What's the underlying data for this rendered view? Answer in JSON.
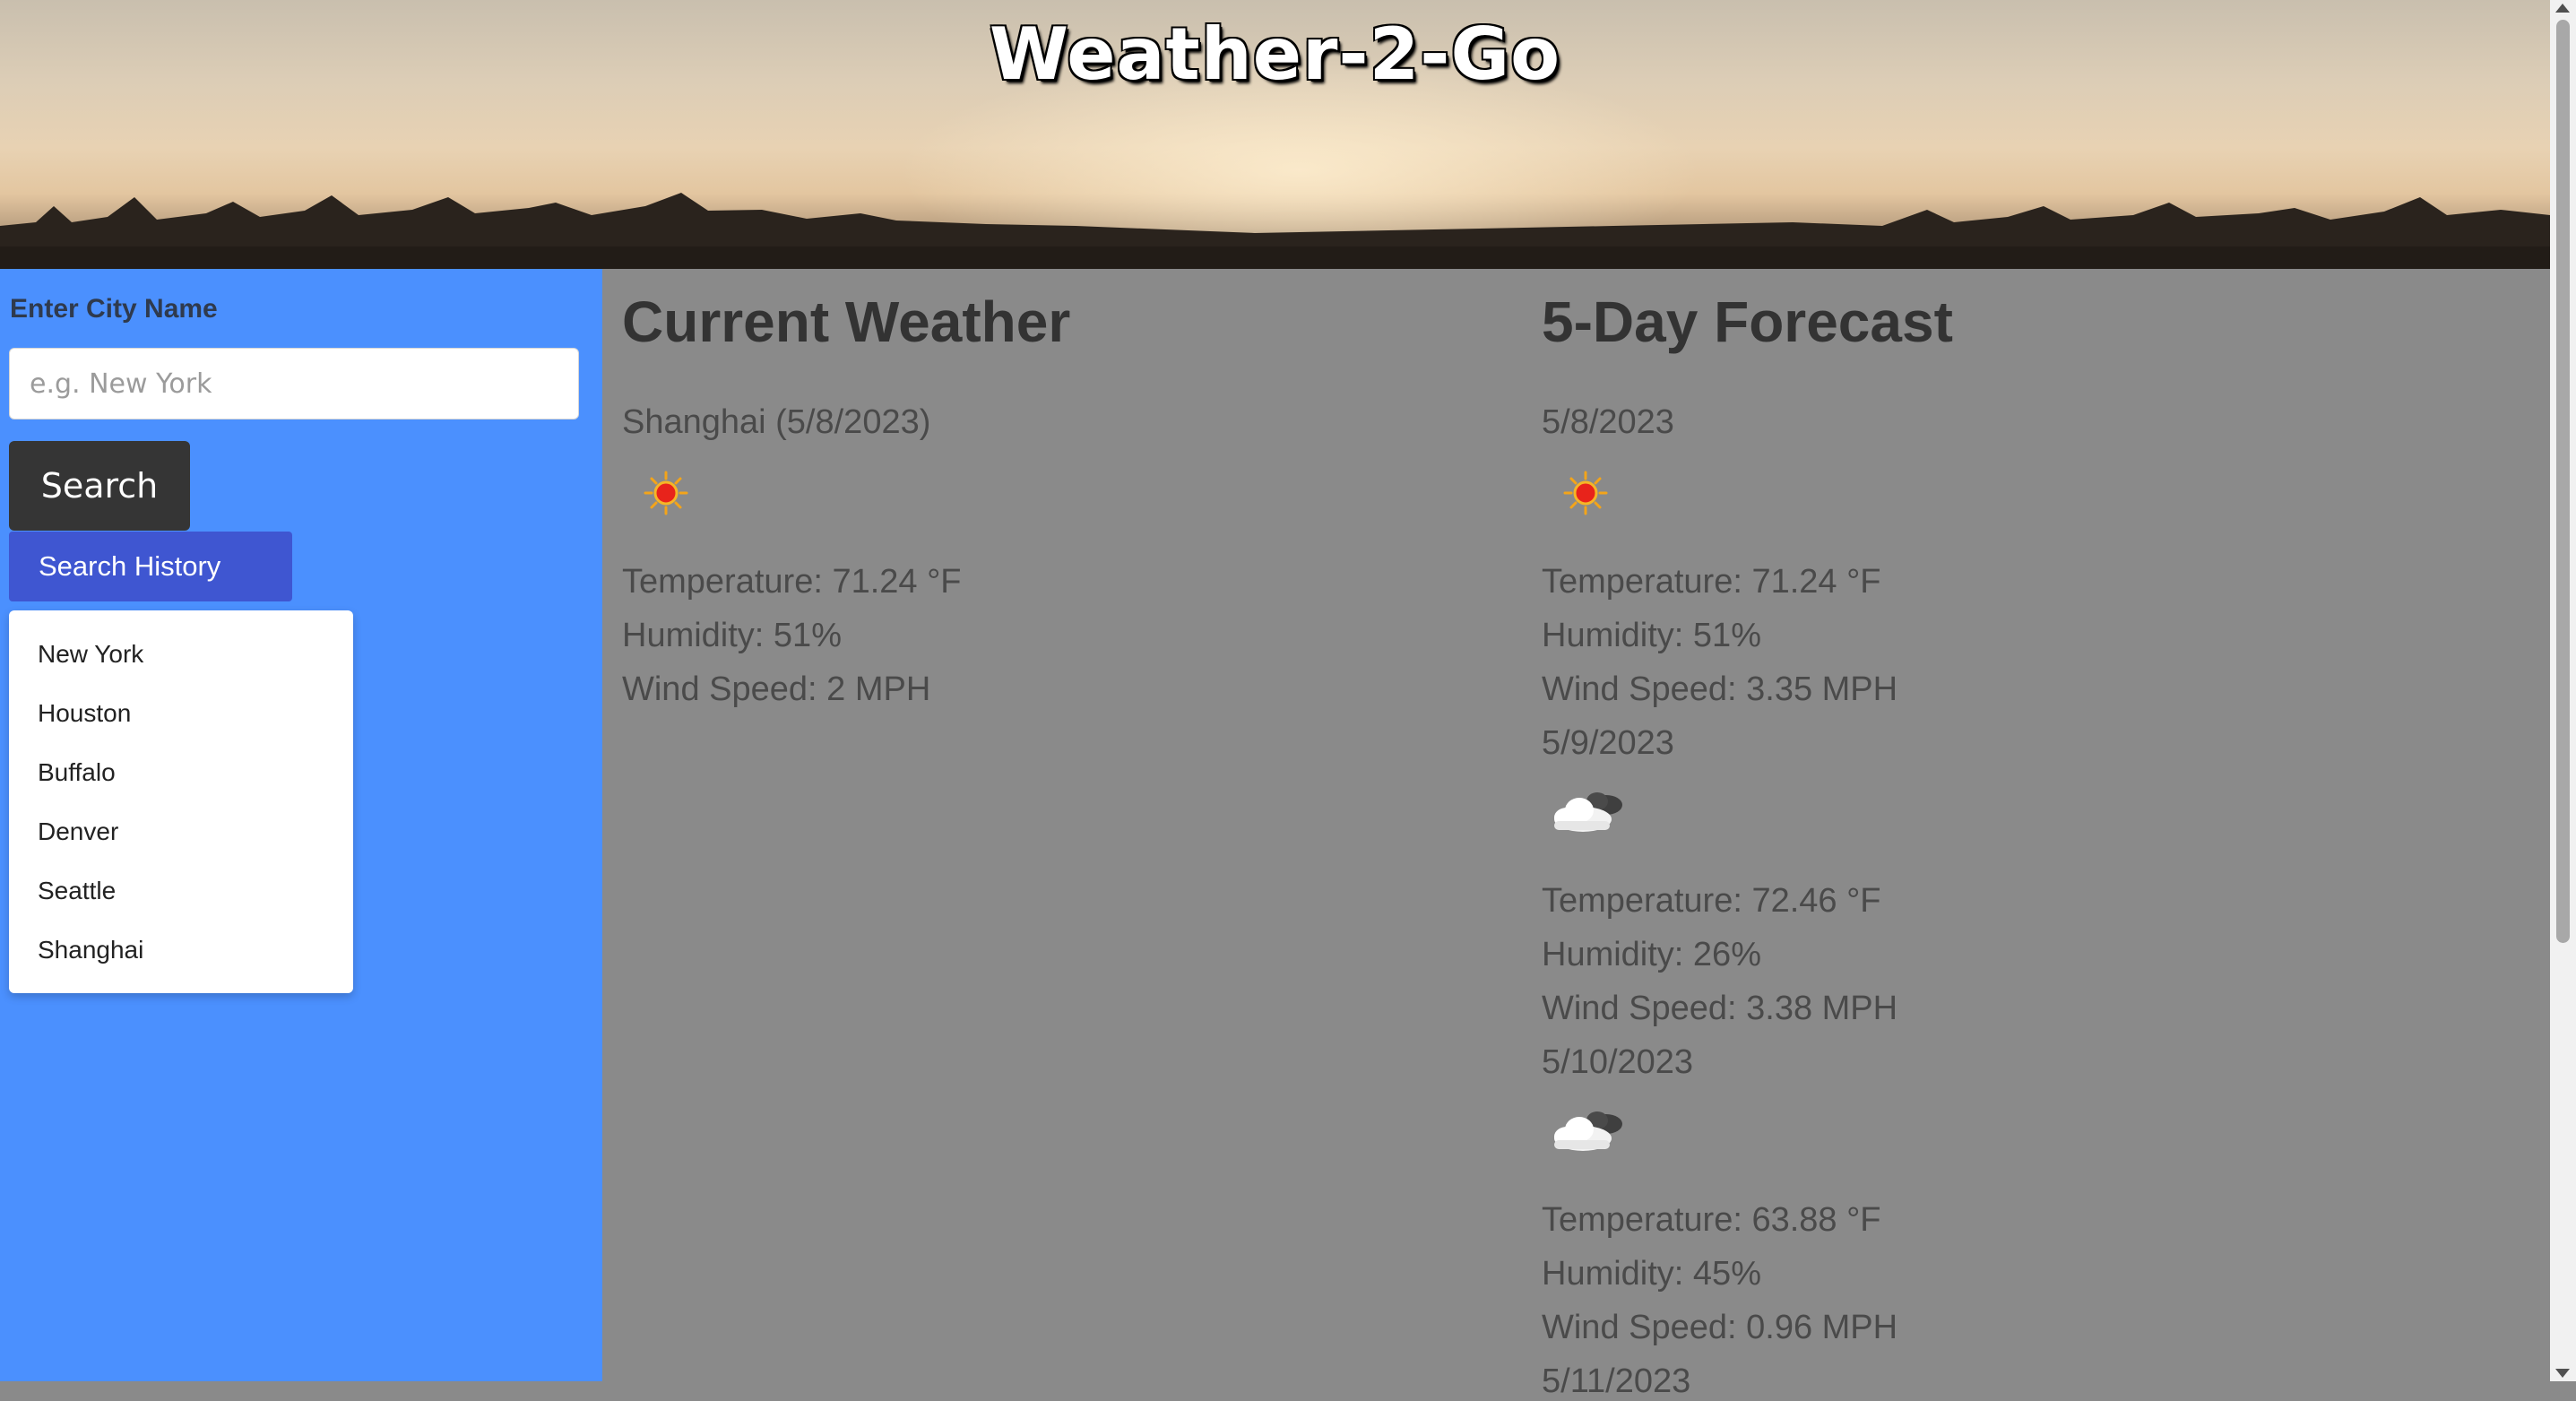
{
  "header": {
    "title": "Weather-2-Go"
  },
  "sidebar": {
    "city_label": "Enter City Name",
    "city_placeholder": "e.g. New York",
    "search_label": "Search",
    "history_label": "Search History",
    "history": [
      "New York",
      "Houston",
      "Buffalo",
      "Denver",
      "Seattle",
      "Shanghai"
    ]
  },
  "current": {
    "title": "Current Weather",
    "location": "Shanghai (5/8/2023)",
    "icon": "sun-icon",
    "temperature": "Temperature: 71.24 °F",
    "humidity": "Humidity: 51%",
    "wind": "Wind Speed: 2 MPH"
  },
  "forecast": {
    "title": "5-Day Forecast",
    "days": [
      {
        "date": "5/8/2023",
        "icon": "sun-icon",
        "temperature": "Temperature: 71.24 °F",
        "humidity": "Humidity: 51%",
        "wind": "Wind Speed: 3.35 MPH"
      },
      {
        "date": "5/9/2023",
        "icon": "clouds-icon",
        "temperature": "Temperature: 72.46 °F",
        "humidity": "Humidity: 26%",
        "wind": "Wind Speed: 3.38 MPH"
      },
      {
        "date": "5/10/2023",
        "icon": "clouds-icon",
        "temperature": "Temperature: 63.88 °F",
        "humidity": "Humidity: 45%",
        "wind": "Wind Speed: 0.96 MPH"
      },
      {
        "date": "5/11/2023"
      }
    ]
  },
  "colors": {
    "sidebar": "#4b90fe",
    "main": "#8a8a8a",
    "search_button": "#353535",
    "history_button": "#3f56d1"
  }
}
